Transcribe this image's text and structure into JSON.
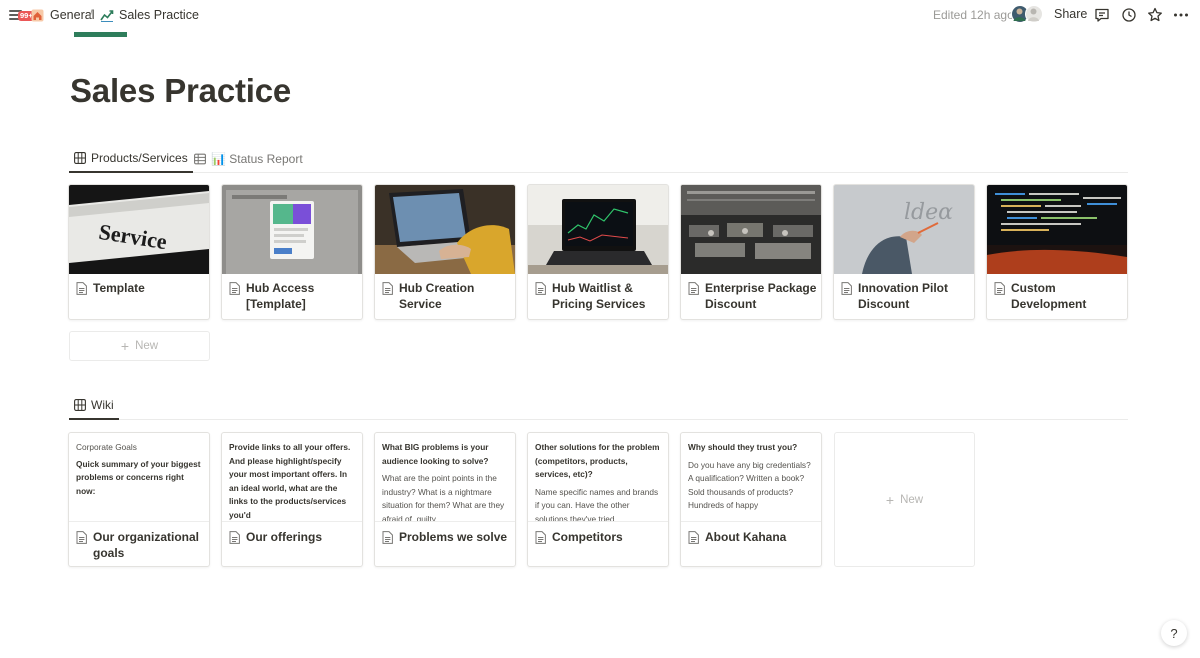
{
  "topbar": {
    "badge": "99+",
    "breadcrumb": [
      {
        "label": "General"
      },
      {
        "label": "Sales Practice"
      }
    ],
    "separator": "/",
    "edited": "Edited 12h ago",
    "share_label": "Share"
  },
  "page": {
    "title": "Sales Practice"
  },
  "products_view": {
    "tabs": [
      {
        "label": "Products/Services",
        "active": true
      },
      {
        "label": "📊 Status Report",
        "active": false
      }
    ],
    "cards": [
      {
        "title": "Template",
        "cover": "service-sign"
      },
      {
        "title": "Hub Access [Template]",
        "cover": "screenshot-card"
      },
      {
        "title": "Hub Creation Service",
        "cover": "laptop-hands"
      },
      {
        "title": "Hub Waitlist & Pricing Services",
        "cover": "stock-chart-laptop"
      },
      {
        "title": "Enterprise Package Discount",
        "cover": "office-floor"
      },
      {
        "title": "Innovation Pilot Discount",
        "cover": "glass-writing"
      },
      {
        "title": "Custom Development",
        "cover": "code-screen"
      }
    ],
    "new_label": "New"
  },
  "wiki_view": {
    "tabs": [
      {
        "label": "Wiki",
        "active": true
      }
    ],
    "cards": [
      {
        "title": "Our organizational goals",
        "preview": [
          {
            "style": "sm",
            "text": "Corporate Goals"
          },
          {
            "style": "h",
            "text": "Quick summary of your biggest problems or concerns right now:"
          }
        ]
      },
      {
        "title": "Our offerings",
        "preview": [
          {
            "style": "h",
            "text": "Provide links to all your offers. And please highlight/specify your most important offers. In an ideal world, what are the links to the products/services you'd"
          }
        ]
      },
      {
        "title": "Problems we solve",
        "preview": [
          {
            "style": "h",
            "text": "What BIG problems is your audience looking to solve?"
          },
          {
            "style": "p",
            "text": "What are the point points in the industry? What is a nightmare situation for them? What are they afraid of, guilty"
          }
        ]
      },
      {
        "title": "Competitors",
        "preview": [
          {
            "style": "h",
            "text": "Other solutions for the problem (competitors, products, services, etc)?"
          },
          {
            "style": "p",
            "text": "Name specific names and brands if you can. Have the other solutions they've tried"
          }
        ]
      },
      {
        "title": "About Kahana",
        "preview": [
          {
            "style": "h",
            "text": "Why should they trust you?"
          },
          {
            "style": "p",
            "text": "Do you have any big credentials? A qualification? Written a book? Sold thousands of products? Hundreds of happy"
          }
        ]
      }
    ],
    "new_label": "New"
  },
  "help_label": "?",
  "colors": {
    "text": "#37352f",
    "muted": "#9b9a97",
    "border": "#e3e2df",
    "badge": "#eb5757",
    "cover_strip": "#2e7d5b"
  },
  "icons": {
    "menu": "hamburger-icon",
    "workspace": "house-icon",
    "page": "chart-page-icon",
    "comments": "comment-icon",
    "updates": "clock-icon",
    "favorite": "star-icon",
    "more": "more-icon",
    "gallery": "gallery-icon",
    "table": "table-icon",
    "doc": "document-icon"
  }
}
